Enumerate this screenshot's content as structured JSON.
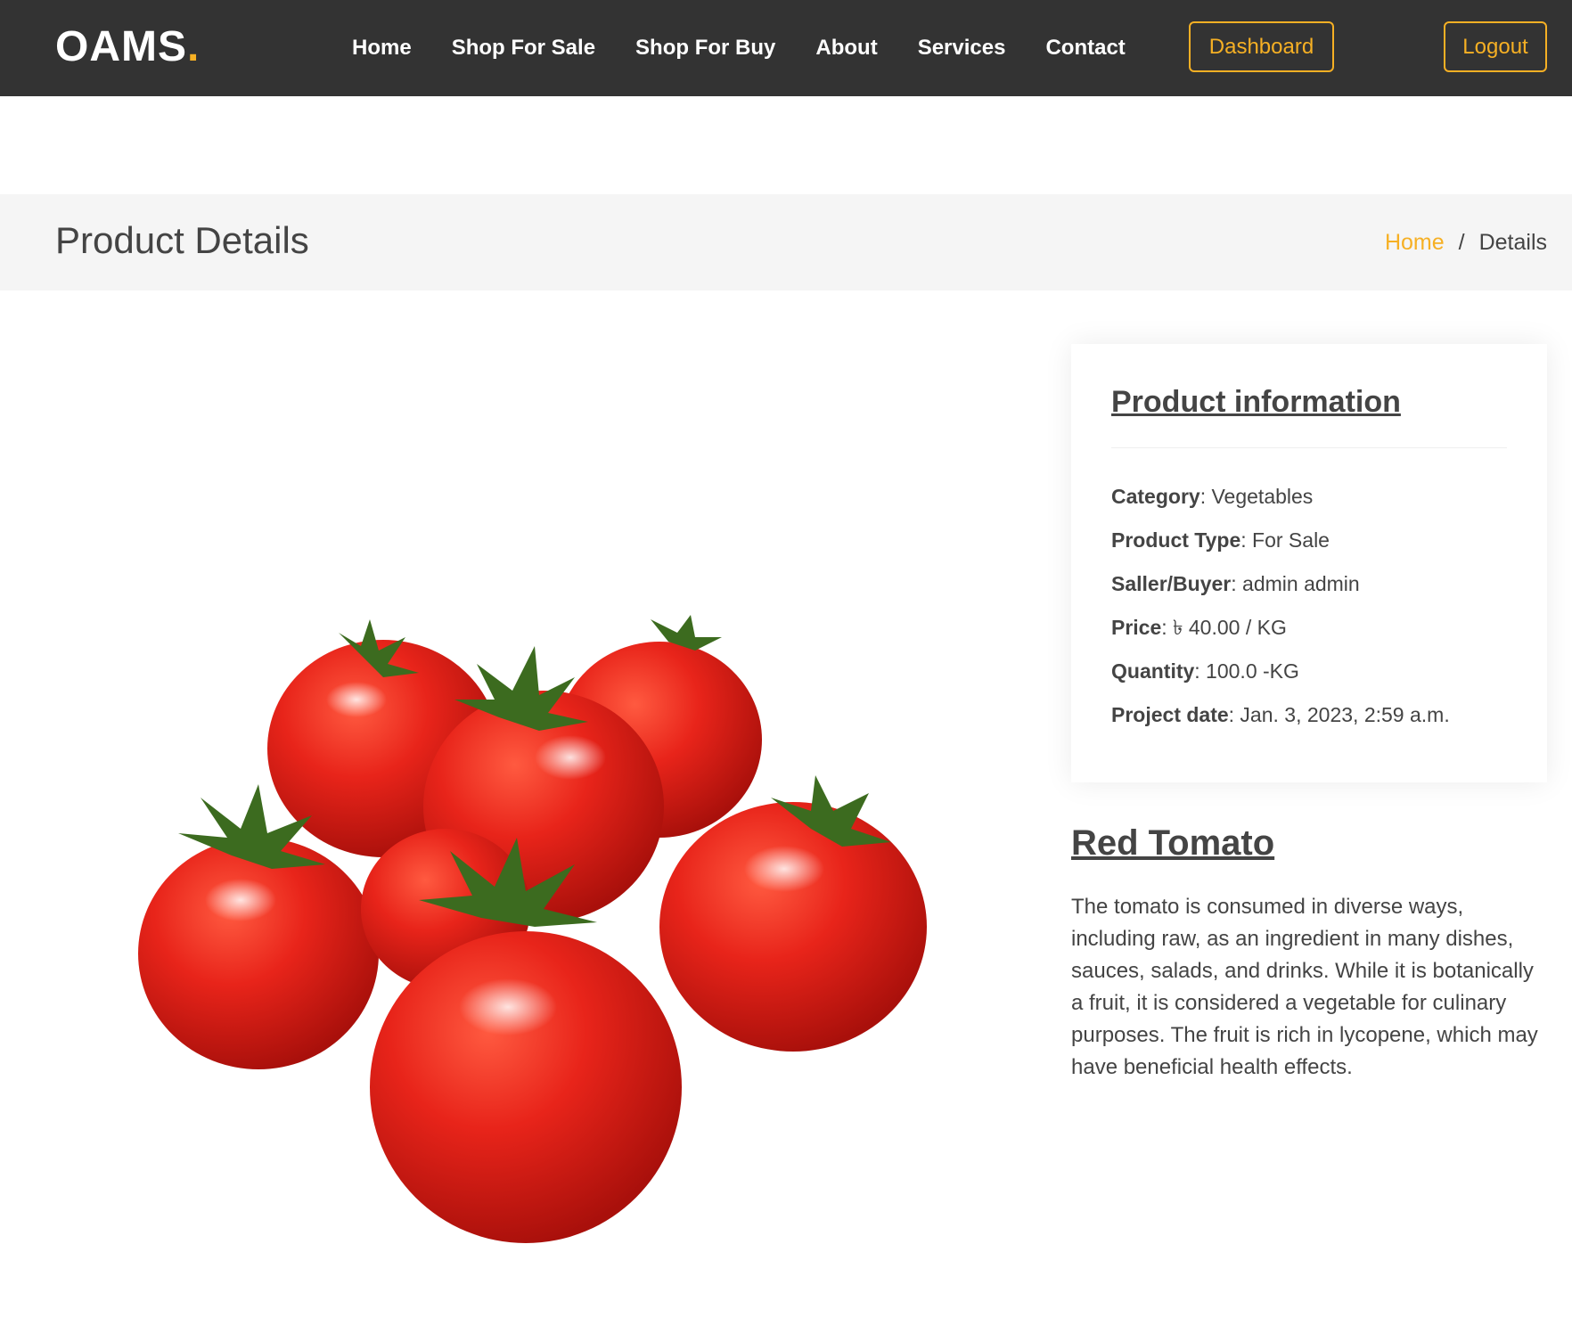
{
  "header": {
    "logo_text": "OAMS",
    "logo_dot": ".",
    "nav": [
      {
        "label": "Home"
      },
      {
        "label": "Shop For Sale"
      },
      {
        "label": "Shop For Buy"
      },
      {
        "label": "About"
      },
      {
        "label": "Services"
      },
      {
        "label": "Contact"
      }
    ],
    "dashboard_label": "Dashboard",
    "logout_label": "Logout"
  },
  "breadcrumbs": {
    "title": "Product Details",
    "home_label": "Home",
    "separator": "/",
    "current": "Details"
  },
  "product_info": {
    "heading": "Product information",
    "rows": [
      {
        "label": "Category",
        "value": ": Vegetables"
      },
      {
        "label": "Product Type",
        "value": ": For Sale"
      },
      {
        "label": "Saller/Buyer",
        "value": ": admin admin"
      },
      {
        "label": "Price",
        "value": ": ৳ 40.00 / KG"
      },
      {
        "label": "Quantity",
        "value": ": 100.0 -KG"
      },
      {
        "label": "Project date",
        "value": ": Jan. 3, 2023, 2:59 a.m."
      }
    ]
  },
  "product": {
    "name": "Red Tomato",
    "description": "The tomato is consumed in diverse ways, including raw, as an ingredient in many dishes, sauces, salads, and drinks. While it is botanically a fruit, it is considered a vegetable for culinary purposes. The fruit is rich in lycopene, which may have beneficial health effects."
  },
  "colors": {
    "accent": "#f6b024",
    "header_bg": "#333333",
    "tomato_red": "#e0261b"
  }
}
